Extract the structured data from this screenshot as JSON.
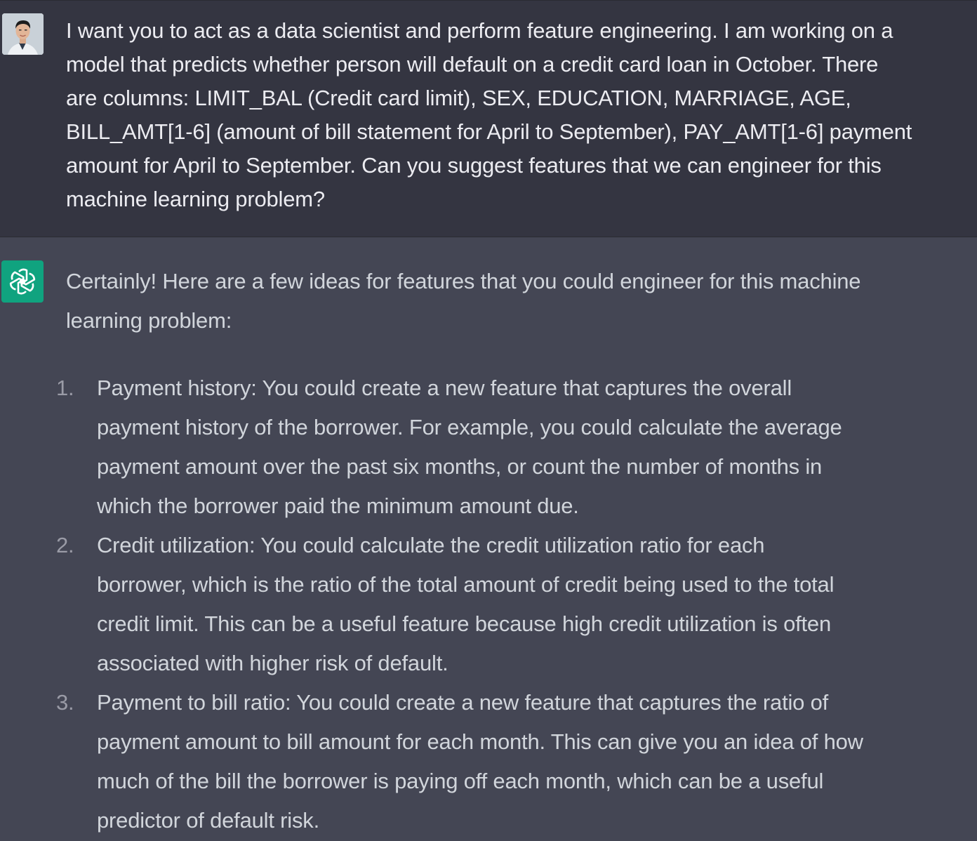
{
  "user_message": {
    "lines": [
      "I want you to act as a data scientist and perform feature engineering. I am working on a",
      "model that predicts whether person will default on a credit card loan in October. There",
      "are columns: LIMIT_BAL (Credit card limit), SEX, EDUCATION, MARRIAGE, AGE,",
      "BILL_AMT[1-6] (amount of bill statement for April to September), PAY_AMT[1-6] payment",
      "amount for April to September. Can you suggest features that we can engineer for this",
      "machine learning problem?"
    ]
  },
  "assistant_message": {
    "intro_lines": [
      "Certainly! Here are a few ideas for features that you could engineer for this machine",
      "learning problem:"
    ],
    "items": [
      {
        "number": "1.",
        "lines": [
          "Payment history: You could create a new feature that captures the overall",
          "payment history of the borrower. For example, you could calculate the average",
          "payment amount over the past six months, or count the number of months in",
          "which the borrower paid the minimum amount due."
        ]
      },
      {
        "number": "2.",
        "lines": [
          "Credit utilization: You could calculate the credit utilization ratio for each",
          "borrower, which is the ratio of the total amount of credit being used to the total",
          "credit limit. This can be a useful feature because high credit utilization is often",
          "associated with higher risk of default."
        ]
      },
      {
        "number": "3.",
        "lines": [
          "Payment to bill ratio: You could create a new feature that captures the ratio of",
          "payment amount to bill amount for each month. This can give you an idea of how",
          "much of the bill the borrower is paying off each month, which can be a useful",
          "predictor of default risk."
        ]
      }
    ]
  },
  "colors": {
    "user_bg": "#343541",
    "assistant_bg": "#444654",
    "assistant_icon_bg": "#10a37f"
  }
}
